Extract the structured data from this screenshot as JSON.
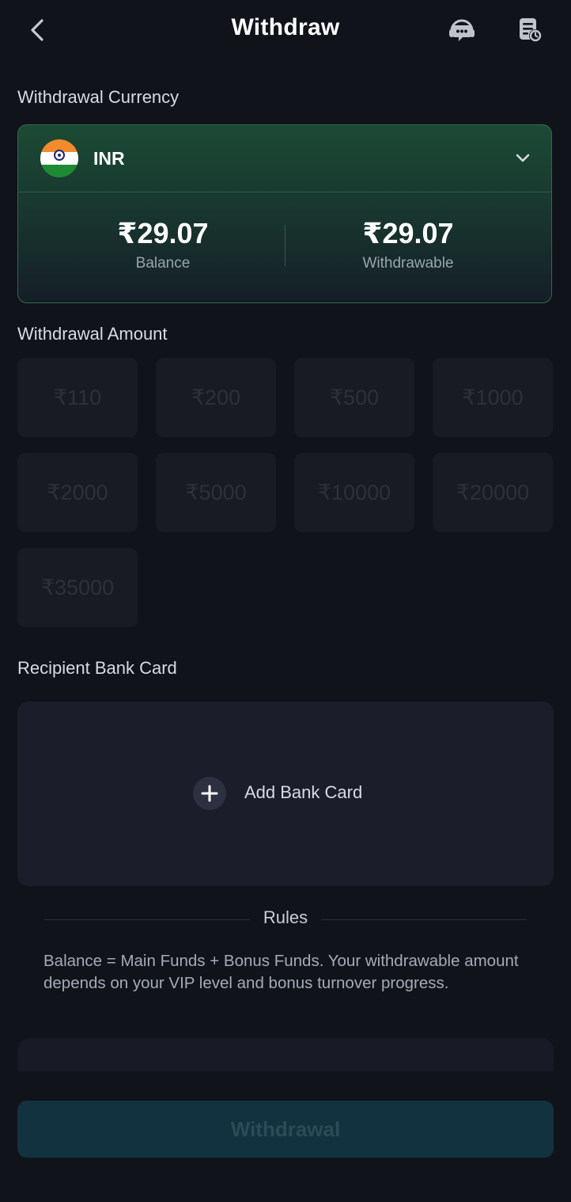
{
  "header": {
    "title": "Withdraw",
    "back_icon": "chevron-left-icon",
    "support_icon": "headset-chat-icon",
    "records_icon": "document-clock-icon"
  },
  "currency": {
    "label": "Withdrawal Currency",
    "code": "INR",
    "flag": "india-flag-icon",
    "balance_value": "₹29.07",
    "balance_label": "Balance",
    "withdrawable_value": "₹29.07",
    "withdrawable_label": "Withdrawable"
  },
  "amount": {
    "label": "Withdrawal Amount",
    "options": [
      "₹110",
      "₹200",
      "₹500",
      "₹1000",
      "₹2000",
      "₹5000",
      "₹10000",
      "₹20000",
      "₹35000"
    ]
  },
  "bank": {
    "label": "Recipient Bank Card",
    "add_label": "Add Bank Card"
  },
  "rules": {
    "title": "Rules",
    "text": "Balance = Main Funds + Bonus Funds. Your withdrawable amount depends on your VIP level and bonus turnover progress."
  },
  "action": {
    "submit_label": "Withdrawal"
  },
  "colors": {
    "background": "#11131b",
    "card_green": "#1c4a35",
    "button_disabled": "#13323f"
  }
}
